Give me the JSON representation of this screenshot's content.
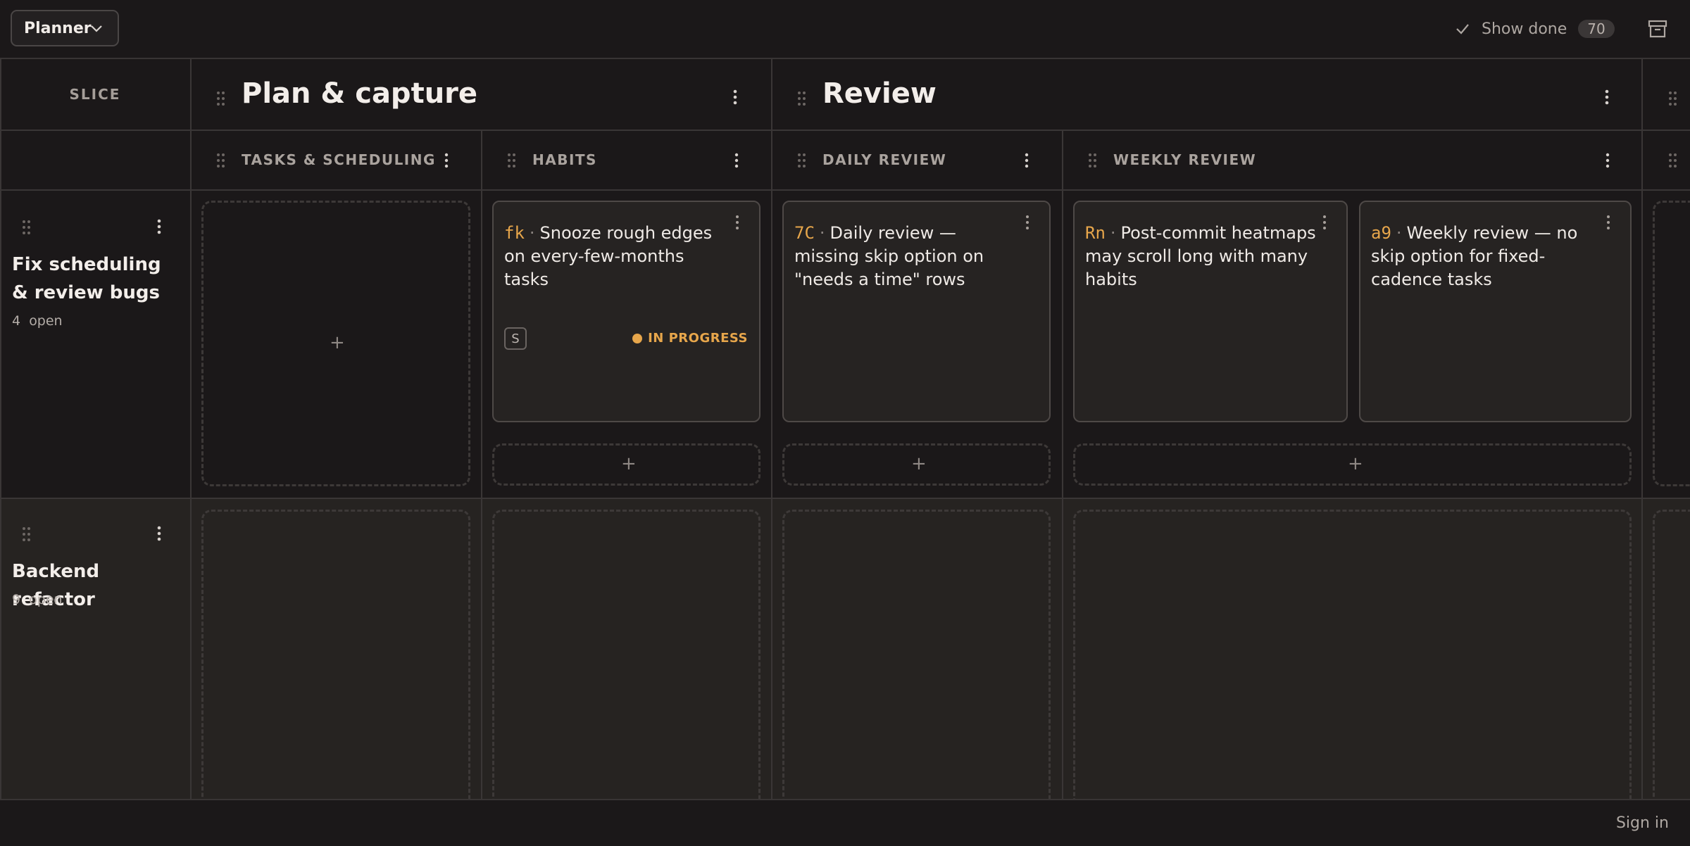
{
  "header": {
    "board_selector": "Planner",
    "show_done_label": "Show done",
    "done_count": "70"
  },
  "board": {
    "slice_header": "SLICE",
    "groups": [
      {
        "title": "Plan & capture"
      },
      {
        "title": "Review"
      }
    ],
    "columns": [
      {
        "title": "TASKS & SCHEDULING"
      },
      {
        "title": "HABITS"
      },
      {
        "title": "DAILY REVIEW"
      },
      {
        "title": "WEEKLY REVIEW"
      }
    ],
    "rows": [
      {
        "title": "Fix scheduling & review bugs",
        "open_count": "4",
        "open_label": "open"
      },
      {
        "title": "Backend refactor",
        "open_count": "9",
        "open_label": "open"
      }
    ],
    "cards": [
      {
        "code": "fk",
        "text": "Snooze rough edges on every-few-months tasks",
        "size": "S",
        "status": "IN PROGRESS"
      },
      {
        "code": "7C",
        "text": "Daily review — missing skip option on \"needs a time\" rows"
      },
      {
        "code": "Rn",
        "text": "Post-commit heatmaps may scroll long with many habits"
      },
      {
        "code": "a9",
        "text": "Weekly review — no skip option for fixed-cadence tasks"
      }
    ]
  },
  "footer": {
    "sign_in": "Sign in"
  },
  "colors": {
    "accent": "#e7a64b",
    "background": "#1b1819",
    "card": "#262322"
  }
}
